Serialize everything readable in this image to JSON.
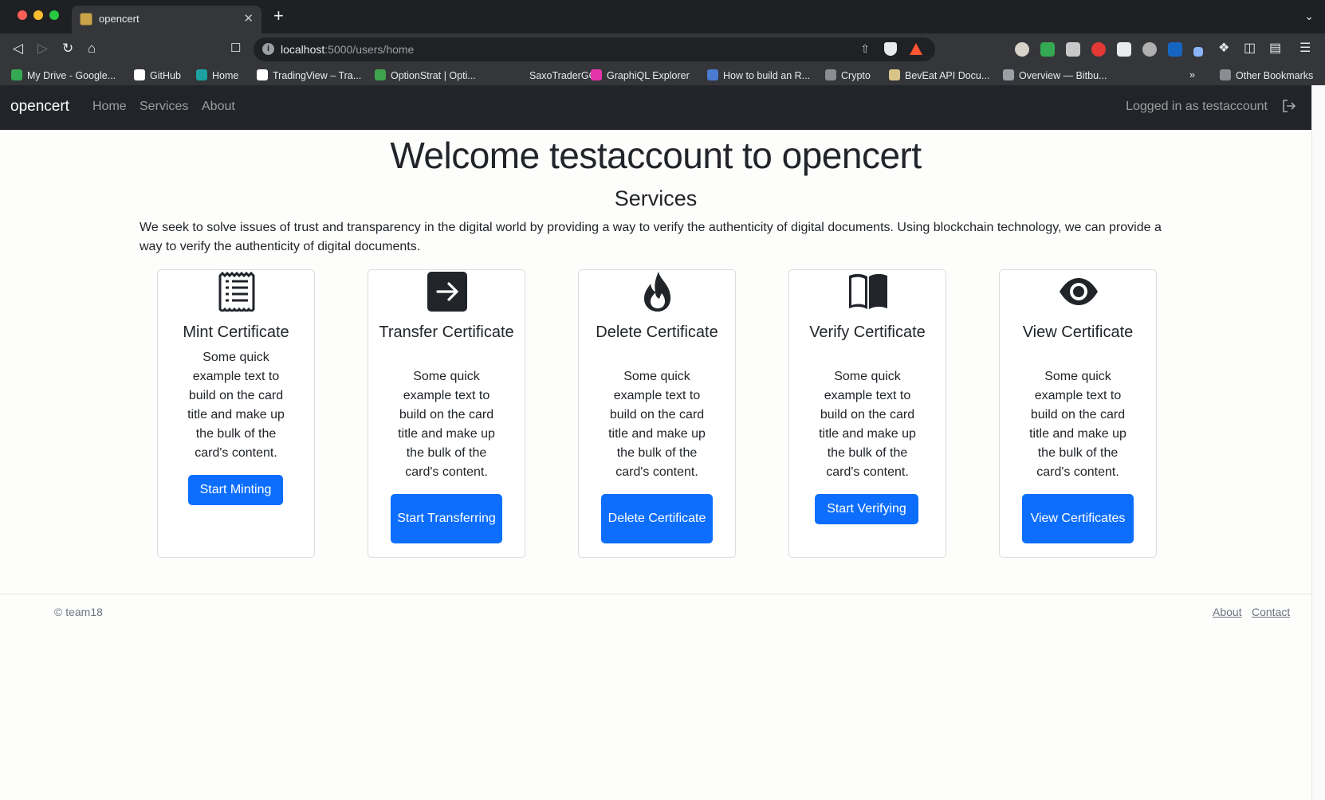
{
  "browser": {
    "tab_title": "opencert",
    "url_host": "localhost",
    "url_path": ":5000/users/home",
    "bookmarks": [
      {
        "label": "My Drive - Google...",
        "color": "#34a853"
      },
      {
        "label": "GitHub",
        "color": "#ffffff"
      },
      {
        "label": "Home",
        "color": "#1da1a1"
      },
      {
        "label": "TradingView – Tra...",
        "color": "#ffffff"
      },
      {
        "label": "OptionStrat | Opti...",
        "color": "#3fa34d"
      },
      {
        "label": "SaxoTraderGO",
        "color": "#35363a"
      },
      {
        "label": "GraphiQL Explorer",
        "color": "#e535ab"
      },
      {
        "label": "How to build an R...",
        "color": "#4a7bd1"
      },
      {
        "label": "Crypto",
        "color": "#8a8d91"
      },
      {
        "label": "BevEat API Docu...",
        "color": "#d9c48a"
      },
      {
        "label": "Overview — Bitbu...",
        "color": "#9aa0a6"
      }
    ],
    "bookmarks_overflow": "»",
    "other_bookmarks": "Other Bookmarks"
  },
  "navbar": {
    "brand": "opencert",
    "links": [
      "Home",
      "Services",
      "About"
    ],
    "logged_in_text": "Logged in as testaccount"
  },
  "main": {
    "welcome": "Welcome testaccount to opencert",
    "services_title": "Services",
    "intro": "We seek to solve issues of trust and transparency in the digital world by providing a way to verify the authenticity of digital documents. Using blockchain technology, we can provide a way to verify the authenticity of digital documents."
  },
  "cards": [
    {
      "icon": "receipt-icon",
      "title": "Mint Certificate",
      "text": "Some quick example text to build on the card title and make up the bulk of the card's content.",
      "button": "Start Minting"
    },
    {
      "icon": "arrow-right-square-icon",
      "title": "Transfer Certificate",
      "text": "Some quick example text to build on the card title and make up the bulk of the card's content.",
      "button": "Start Transferring"
    },
    {
      "icon": "fire-icon",
      "title": "Delete Certificate",
      "text": "Some quick example text to build on the card title and make up the bulk of the card's content.",
      "button": "Delete Certificate"
    },
    {
      "icon": "book-icon",
      "title": "Verify Certificate",
      "text": "Some quick example text to build on the card title and make up the bulk of the card's content.",
      "button": "Start Verifying"
    },
    {
      "icon": "eye-icon",
      "title": "View Certificate",
      "text": "Some quick example text to build on the card title and make up the bulk of the card's content.",
      "button": "View Certificates"
    }
  ],
  "footer": {
    "copyright": "© team18",
    "links": [
      "About",
      "Contact"
    ]
  },
  "colors": {
    "primary": "#0d6efd",
    "navbar": "#212529"
  }
}
